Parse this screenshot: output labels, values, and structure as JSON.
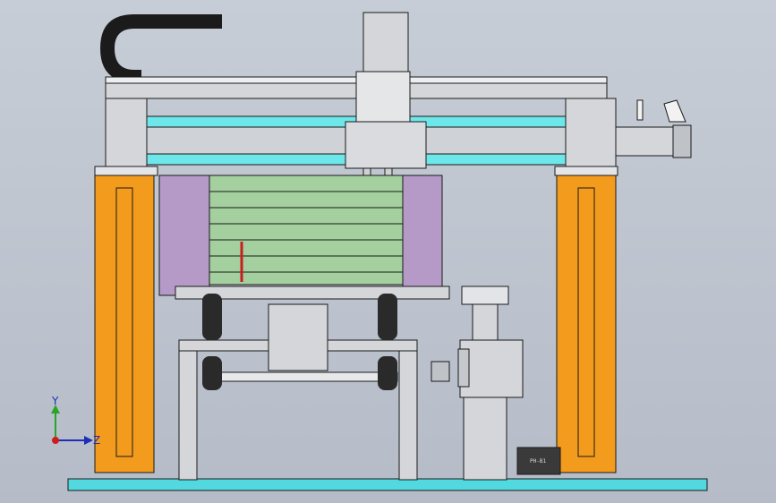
{
  "viewport": {
    "background_top": "#c7cdd6",
    "background_bottom": "#b5bcc8"
  },
  "colors": {
    "column_orange": "#f39b1c",
    "rail_cyan": "#6ee7ea",
    "panel_violet": "#b59ac7",
    "drawer_green": "#a4cf9e",
    "steel_gray": "#d4d6da",
    "dark": "#1a1a1a",
    "base_cyan": "#52d8df",
    "axis_blue": "#1d2fb8",
    "axis_green": "#2aa52a",
    "axis_red": "#d11c1c"
  },
  "axes": {
    "y_label": "Y",
    "z_label": "Z"
  },
  "motor_plate": {
    "label": "PH-B1"
  }
}
